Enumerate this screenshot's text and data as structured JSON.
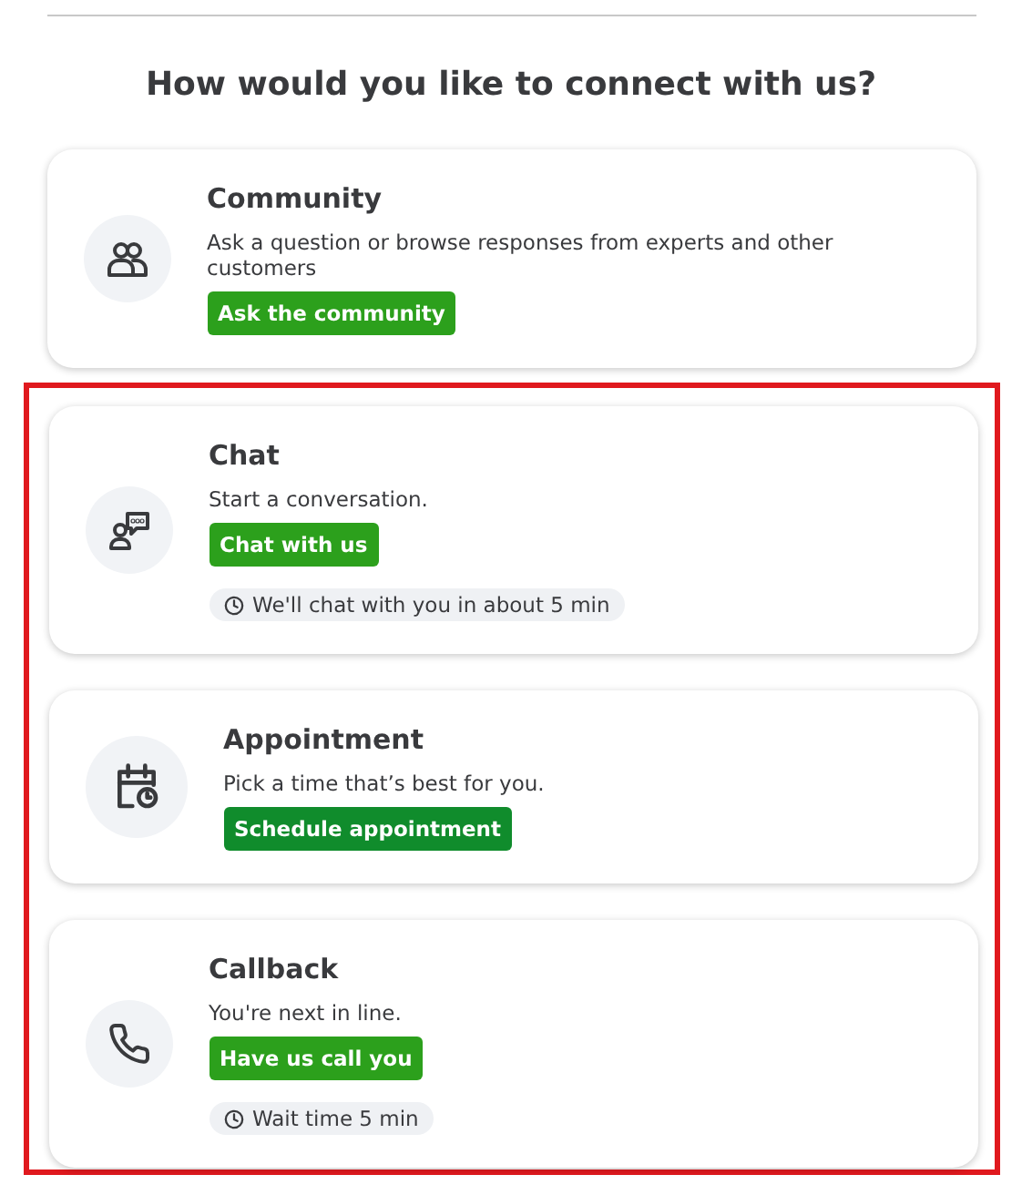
{
  "heading": "How would you like to connect with us?",
  "options": [
    {
      "kind": "community",
      "title": "Community",
      "description": "Ask a question or browse responses from experts and other customers",
      "button": "Ask the community",
      "color": "#2ca01c"
    }
  ],
  "highlighted_options": [
    {
      "kind": "chat",
      "title": "Chat",
      "description": "Start a conversation.",
      "button": "Chat with us",
      "color": "#2ca01c",
      "wait": "We'll chat with you in about 5 min"
    },
    {
      "kind": "appointment",
      "title": "Appointment",
      "description": "Pick a time that’s best for you.",
      "button": "Schedule appointment",
      "color": "#108c2c"
    },
    {
      "kind": "callback",
      "title": "Callback",
      "description": "You're next in line.",
      "button": "Have us call you",
      "color": "#2ca01c",
      "wait": "Wait time 5 min"
    }
  ]
}
